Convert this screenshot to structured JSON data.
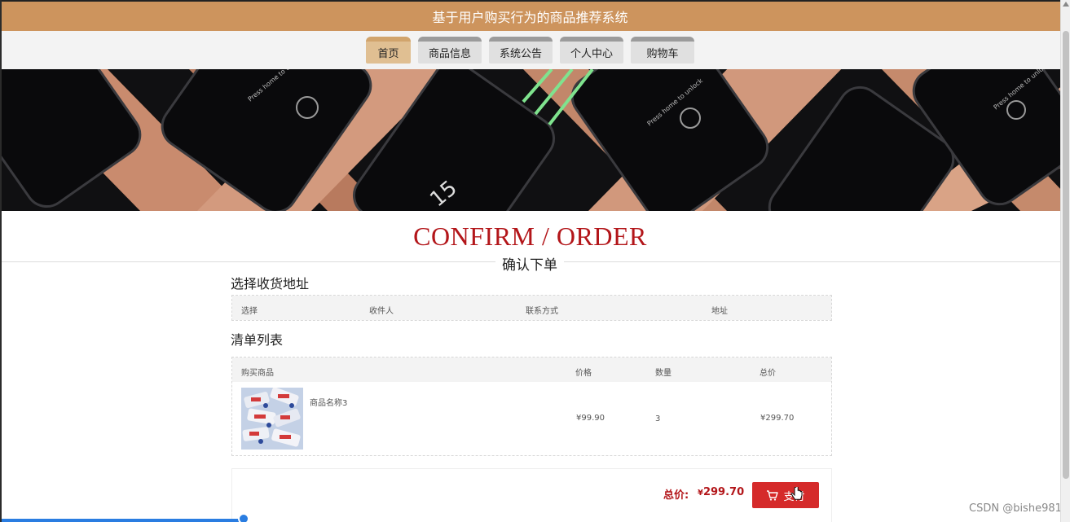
{
  "header": {
    "title": "基于用户购买行为的商品推荐系统"
  },
  "nav": {
    "tabs": [
      {
        "label": "首页",
        "active": true
      },
      {
        "label": "商品信息",
        "active": false
      },
      {
        "label": "系统公告",
        "active": false
      },
      {
        "label": "个人中心",
        "active": false
      },
      {
        "label": "购物车",
        "active": false
      }
    ]
  },
  "banner": {
    "icon": "phones-banner-image"
  },
  "page": {
    "heading_en": "CONFIRM / ORDER",
    "heading_cn": "确认下单"
  },
  "address": {
    "section_title": "选择收货地址",
    "columns": [
      "选择",
      "收件人",
      "联系方式",
      "地址"
    ]
  },
  "order_list": {
    "section_title": "清单列表",
    "columns": [
      "购买商品",
      "价格",
      "数量",
      "总价"
    ],
    "rows": [
      {
        "name": "商品名称3",
        "price": "¥99.90",
        "quantity": "3",
        "total": "¥299.70"
      }
    ]
  },
  "summary": {
    "total_label": "总价:",
    "currency": "¥",
    "total_value": "299.70",
    "pay_button": "支付"
  },
  "watermark": "CSDN @bishe981",
  "colors": {
    "header_bg": "#cd945d",
    "active_tab": "#e0bf92",
    "accent_red": "#b3161a",
    "pay_button": "#d52a2a"
  }
}
